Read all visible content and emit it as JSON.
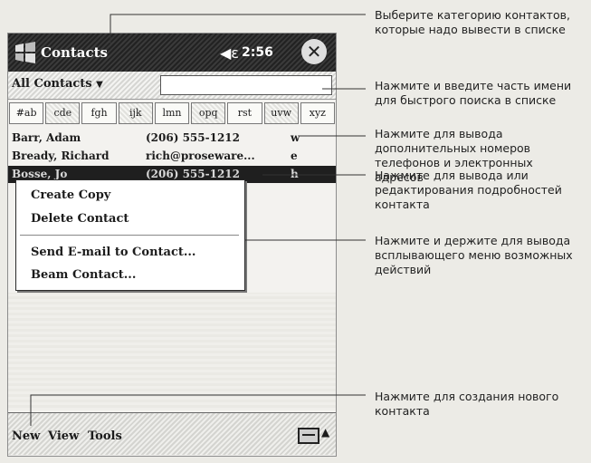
{
  "app": {
    "title": "Contacts",
    "time": "2:56",
    "close": "✕",
    "speaker": "◀ε"
  },
  "category": {
    "label": "All Contacts",
    "search_value": ""
  },
  "tabs": [
    "#ab",
    "cde",
    "fgh",
    "ijk",
    "lmn",
    "opq",
    "rst",
    "uvw",
    "xyz"
  ],
  "contacts": [
    {
      "name": "Barr, Adam",
      "value": "(206) 555-1212",
      "tag": "w"
    },
    {
      "name": "Bready, Richard",
      "value": "rich@proseware...",
      "tag": "e"
    },
    {
      "name": "Bosse, Jo",
      "value": "(206) 555-1212",
      "tag": "h"
    }
  ],
  "popup": {
    "items": [
      "Create Copy",
      "Delete Contact",
      "Send E-mail to Contact...",
      "Beam Contact..."
    ]
  },
  "commands": {
    "new": "New",
    "view": "View",
    "tools": "Tools"
  },
  "callouts": [
    "Выберите категорию контактов, которые надо вывести в списке",
    "Нажмите и введите часть имени для быстрого поиска в списке",
    "Нажмите для вывода дополнительных номеров телефонов и электронных адресов",
    "Нажмите для вывода или редактирования подробностей контакта",
    "Нажмите и держите для вывода всплывающего меню возможных действий",
    "Нажмите для создания нового контакта"
  ]
}
